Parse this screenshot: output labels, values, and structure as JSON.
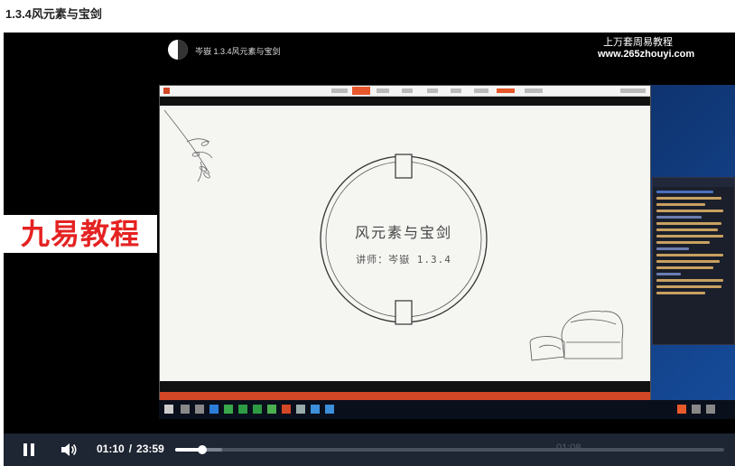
{
  "page": {
    "title": "1.3.4风元素与宝剑"
  },
  "video": {
    "header_title": "岑嶽 1.3.4风元素与宝剑",
    "brand_cn": "上万套周易教程",
    "brand_url": "www.265zhouyi.com",
    "watermark": "九易教程"
  },
  "slide": {
    "title": "风元素与宝剑",
    "subtitle": "讲师：岑嶽 1.3.4"
  },
  "player": {
    "current_time": "01:10",
    "separator": "/",
    "duration": "23:59",
    "played_fraction": 0.049,
    "buffered_fraction": 0.085,
    "ghost_time": "01:08"
  },
  "colors": {
    "accent_red": "#e52222",
    "ppt_orange": "#d24726",
    "control_bar": "#1e2533"
  }
}
